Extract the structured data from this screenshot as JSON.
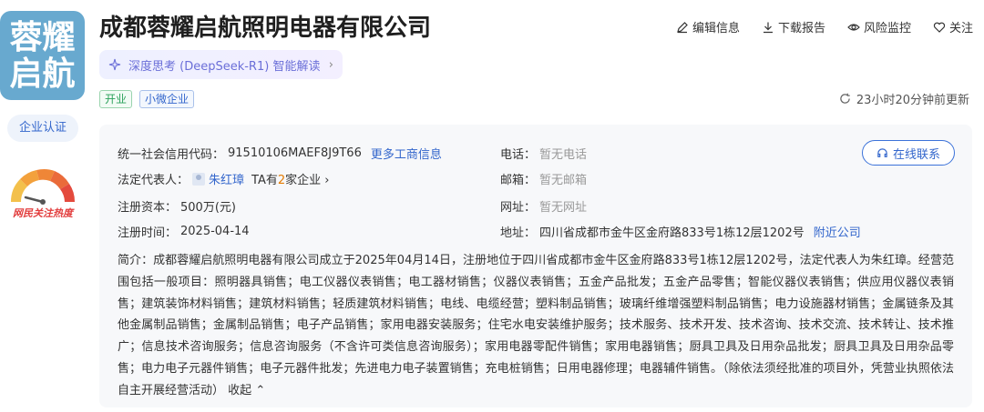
{
  "company": {
    "logo_text": [
      "蓉耀",
      "启航"
    ],
    "name": "成都蓉耀启航照明电器有限公司",
    "tags": [
      "开业",
      "小微企业"
    ],
    "cert_label": "企业认证",
    "heat_label": "网民关注热度"
  },
  "actions": [
    {
      "icon": "edit-icon",
      "label": "编辑信息"
    },
    {
      "icon": "download-icon",
      "label": "下载报告"
    },
    {
      "icon": "eye-icon",
      "label": "风险监控"
    },
    {
      "icon": "heart-icon",
      "label": "关注"
    }
  ],
  "ai": {
    "label": "深度思考 (DeepSeek-R1) 智能解读"
  },
  "updated": "23小时20分钟前更新",
  "info": {
    "credit_code_label": "统一社会信用代码：",
    "credit_code": "91510106MAEF8J9T66",
    "more_link": "更多工商信息",
    "legal_label": "法定代表人：",
    "legal_name": "朱红璋",
    "legal_ta_prefix": "TA有",
    "legal_ta_count": "2",
    "legal_ta_suffix": "家企业",
    "capital_label": "注册资本：",
    "capital": "500万(元)",
    "date_label": "注册时间：",
    "date": "2025-04-14",
    "phone_label": "电话：",
    "phone": "暂无电话",
    "email_label": "邮箱：",
    "email": "暂无邮箱",
    "website_label": "网址：",
    "website": "暂无网址",
    "address_label": "地址：",
    "address": "四川省成都市金牛区金府路833号1栋12层1202号",
    "nearby_link": "附近公司",
    "contact_btn": "在线联系"
  },
  "intro": {
    "text": "简介：成都蓉耀启航照明电器有限公司成立于2025年04月14日，注册地位于四川省成都市金牛区金府路833号1栋12层1202号，法定代表人为朱红璋。经营范围包括一般项目：照明器具销售；电工仪器仪表销售；电工器材销售；仪器仪表销售；五金产品批发；五金产品零售；智能仪器仪表销售；供应用仪器仪表销售；建筑装饰材料销售；建筑材料销售；轻质建筑材料销售；电线、电缆经营；塑料制品销售；玻璃纤维增强塑料制品销售；电力设施器材销售；金属链条及其他金属制品销售；金属制品销售；电子产品销售；家用电器安装服务；住宅水电安装维护服务；技术服务、技术开发、技术咨询、技术交流、技术转让、技术推广；信息技术咨询服务；信息咨询服务（不含许可类信息咨询服务）；家用电器零配件销售；家用电器销售；厨具卫具及日用杂品批发；厨具卫具及日用杂品零售；电力电子元器件销售；电子元器件批发；先进电力电子装置销售；充电桩销售；日用电器修理；电器辅件销售。（除依法须经批准的项目外，凭营业执照依法自主开展经营活动）",
    "collapse_label": "收起"
  }
}
